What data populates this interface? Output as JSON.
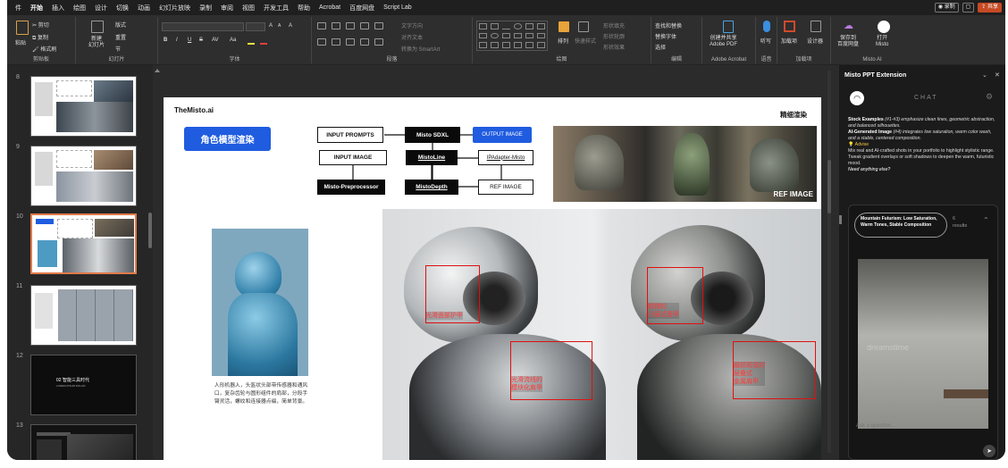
{
  "menubar": {
    "tabs": [
      "件",
      "开始",
      "插入",
      "绘图",
      "设计",
      "切换",
      "动画",
      "幻灯片放映",
      "录制",
      "审阅",
      "视图",
      "开发工具",
      "帮助",
      "Acrobat",
      "百度网盘",
      "Script Lab"
    ],
    "active": "开始",
    "record": "◉ 录制",
    "comment": "▢",
    "share": "⇪ 共享"
  },
  "ribbon": {
    "groups": [
      "剪贴板",
      "幻灯片",
      "字体",
      "段落",
      "绘图",
      "编辑",
      "Adobe Acrobat",
      "语音",
      "加载项",
      "Misto AI"
    ],
    "clipboard": {
      "paste": "粘贴",
      "cut": "✂ 剪切",
      "copy": "⧉ 复制",
      "format": "🖌 格式刷"
    },
    "slides": {
      "new": "新建\n幻灯片",
      "layout": "版式",
      "reset": "重置",
      "section": "节"
    },
    "font": {
      "bold": "B",
      "italic": "I",
      "underline": "U",
      "strike": "S",
      "spacing": "AV",
      "size_up": "A",
      "size_down": "A",
      "case": "Aa",
      "clear": "A"
    },
    "paragraph": {
      "dir": "文字方向",
      "align": "对齐文本",
      "smartart": "转换为 SmartArt"
    },
    "drawing": {
      "arrange": "排列",
      "quick": "快速样式",
      "fill": "形状填充",
      "outline": "形状轮廓",
      "effect": "形状效果"
    },
    "editing": {
      "find": "查找和替换",
      "replace": "替换字体",
      "select": "选择"
    },
    "acrobat": {
      "create": "创建并共享\nAdobe PDF"
    },
    "voice": {
      "dictate": "听写"
    },
    "addins": {
      "addins": "加载项"
    },
    "misto": {
      "design": "设计器",
      "save": "保存到\n百度网盘",
      "open": "打开\nMisto"
    }
  },
  "thumbnails": [
    {
      "num": "8"
    },
    {
      "num": "9"
    },
    {
      "num": "10"
    },
    {
      "num": "11"
    },
    {
      "num": "12"
    },
    {
      "num": "13"
    }
  ],
  "thumb_text": {
    "t12_title": "02 智能三具时代",
    "t12_sub": "LOREM IPSUM DOLOR"
  },
  "slide": {
    "logo": "TheMisto.ai",
    "title": "角色模型渲染",
    "subtitle": "精细渲染",
    "flow": {
      "input_prompts": "INPUT PROMPTS",
      "misto_sdxl": "Misto SDXL",
      "output_image": "OUTPUT IMAGE",
      "input_image": "INPUT IMAGE",
      "misto_line": "MistoLine",
      "ip_adapter": "IPAdapter-Misto",
      "preprocessor": "Misto-Preprocessor",
      "misto_depth": "MistoDepth",
      "ref_image": "REF IMAGE"
    },
    "ref_label": "REF IMAGE",
    "caption": "人形机器人，头盔状头部带传感器和通风口，复杂齿轮与圆形组件的肩部，分段手臂灵活，螺纹和连接器点缀，简单背景。",
    "annotations_left": [
      "光滑面部护甲",
      "光滑流线的\n模块化肩甲"
    ],
    "annotations_right": [
      "粗糙的\n分层式面甲",
      "磨损斑驳的\n层叠式\n金属肩甲"
    ]
  },
  "sidepanel": {
    "title": "Misto PPT Extension",
    "chat_label": "CHAT",
    "chat_lines": [
      {
        "b": "Stock Examples",
        "t": " (#1-#3) emphasize clean lines, geometric abstraction, and balanced silhouettes."
      },
      {
        "b": "AI-Generated Image",
        "t": " (#4) integrates low saturation, warm color wash, and a stable, centered composition."
      }
    ],
    "advise_label": "💡 Advise",
    "advise_lines": [
      "Mix real and AI-crafted shots in your portfolio to highlight stylistic range.",
      "Tweak gradient overlays or soft shadows to deepen the warm, futuristic mood."
    ],
    "question": "Need anything else?",
    "result_tag": "Mountain Futurism: Low Saturation, Warm Tones, Stable Composition",
    "result_count": "6",
    "result_word": "results",
    "watermark": "dreamstime",
    "ask_placeholder": "Ask a question...",
    "send_icon": "➤"
  },
  "colors": {
    "accent": "#1f5ce0",
    "annotation": "#e01010",
    "share": "#c64a24",
    "thumb_selected": "#e07a4a"
  }
}
